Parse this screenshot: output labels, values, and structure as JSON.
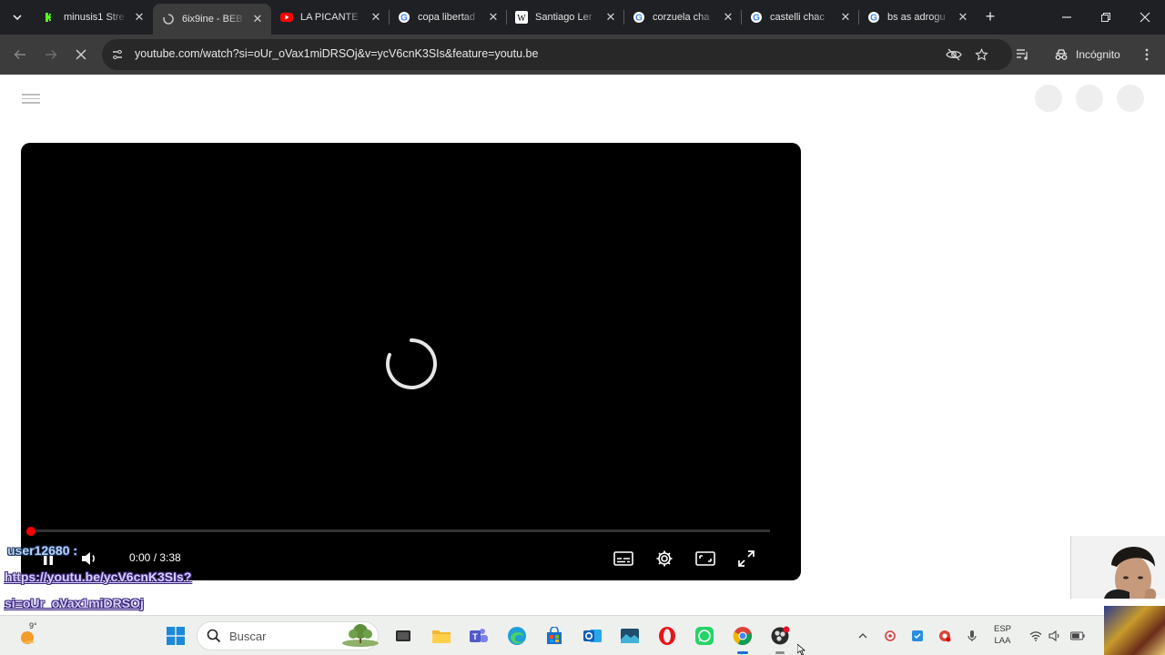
{
  "browser": {
    "tabs": [
      {
        "title": "minusis1 Stre",
        "favicon": "kick-icon",
        "active": false
      },
      {
        "title": "6ix9ine - BEB",
        "favicon": "loading-icon",
        "active": true
      },
      {
        "title": "LA PICANTE",
        "favicon": "youtube-icon",
        "active": false
      },
      {
        "title": "copa libertad",
        "favicon": "google-icon",
        "active": false
      },
      {
        "title": "Santiago Ler",
        "favicon": "wikipedia-icon",
        "active": false
      },
      {
        "title": "corzuela cha",
        "favicon": "google-icon",
        "active": false
      },
      {
        "title": "castelli chac",
        "favicon": "google-icon",
        "active": false
      },
      {
        "title": "bs as adrogu",
        "favicon": "google-icon",
        "active": false
      }
    ],
    "url": "youtube.com/watch?si=oUr_oVax1miDRSOj&v=ycV6cnK3SIs&feature=youtu.be",
    "incognito_label": "Incógnito"
  },
  "player": {
    "time_display": "0:00 / 3:38",
    "progress": 0,
    "accent": "#ff0000"
  },
  "overlay": {
    "chat_user": "user12680 :",
    "chat_line1": "https://youtu.be/ycV6cnK3SIs?",
    "chat_line2": "si=oUr_oVax1miDRSOj"
  },
  "taskbar": {
    "weather_temp": "9°",
    "search_placeholder": "Buscar",
    "lang_line1": "ESP",
    "lang_line2": "LAA"
  }
}
